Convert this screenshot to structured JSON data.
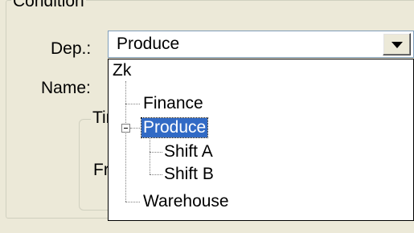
{
  "condition": {
    "title": "Condition",
    "dep_label": "Dep.:",
    "name_label": "Name:",
    "dep_value": "Produce",
    "time_group_title_fragment": "Tir",
    "from_label_fragment": "Fr"
  },
  "tree": {
    "root": "Zk",
    "items": [
      {
        "label": "Finance"
      },
      {
        "label": "Produce",
        "selected": true,
        "expanded": true,
        "children": [
          {
            "label": "Shift A"
          },
          {
            "label": "Shift B"
          }
        ]
      },
      {
        "label": "Warehouse"
      }
    ]
  },
  "colors": {
    "selection": "#316ac5",
    "window_bg": "#ece9d8",
    "field_border": "#7f9db9"
  },
  "icons": {
    "combo_button": "chevron-down-icon",
    "expander": "minus-box-icon"
  }
}
